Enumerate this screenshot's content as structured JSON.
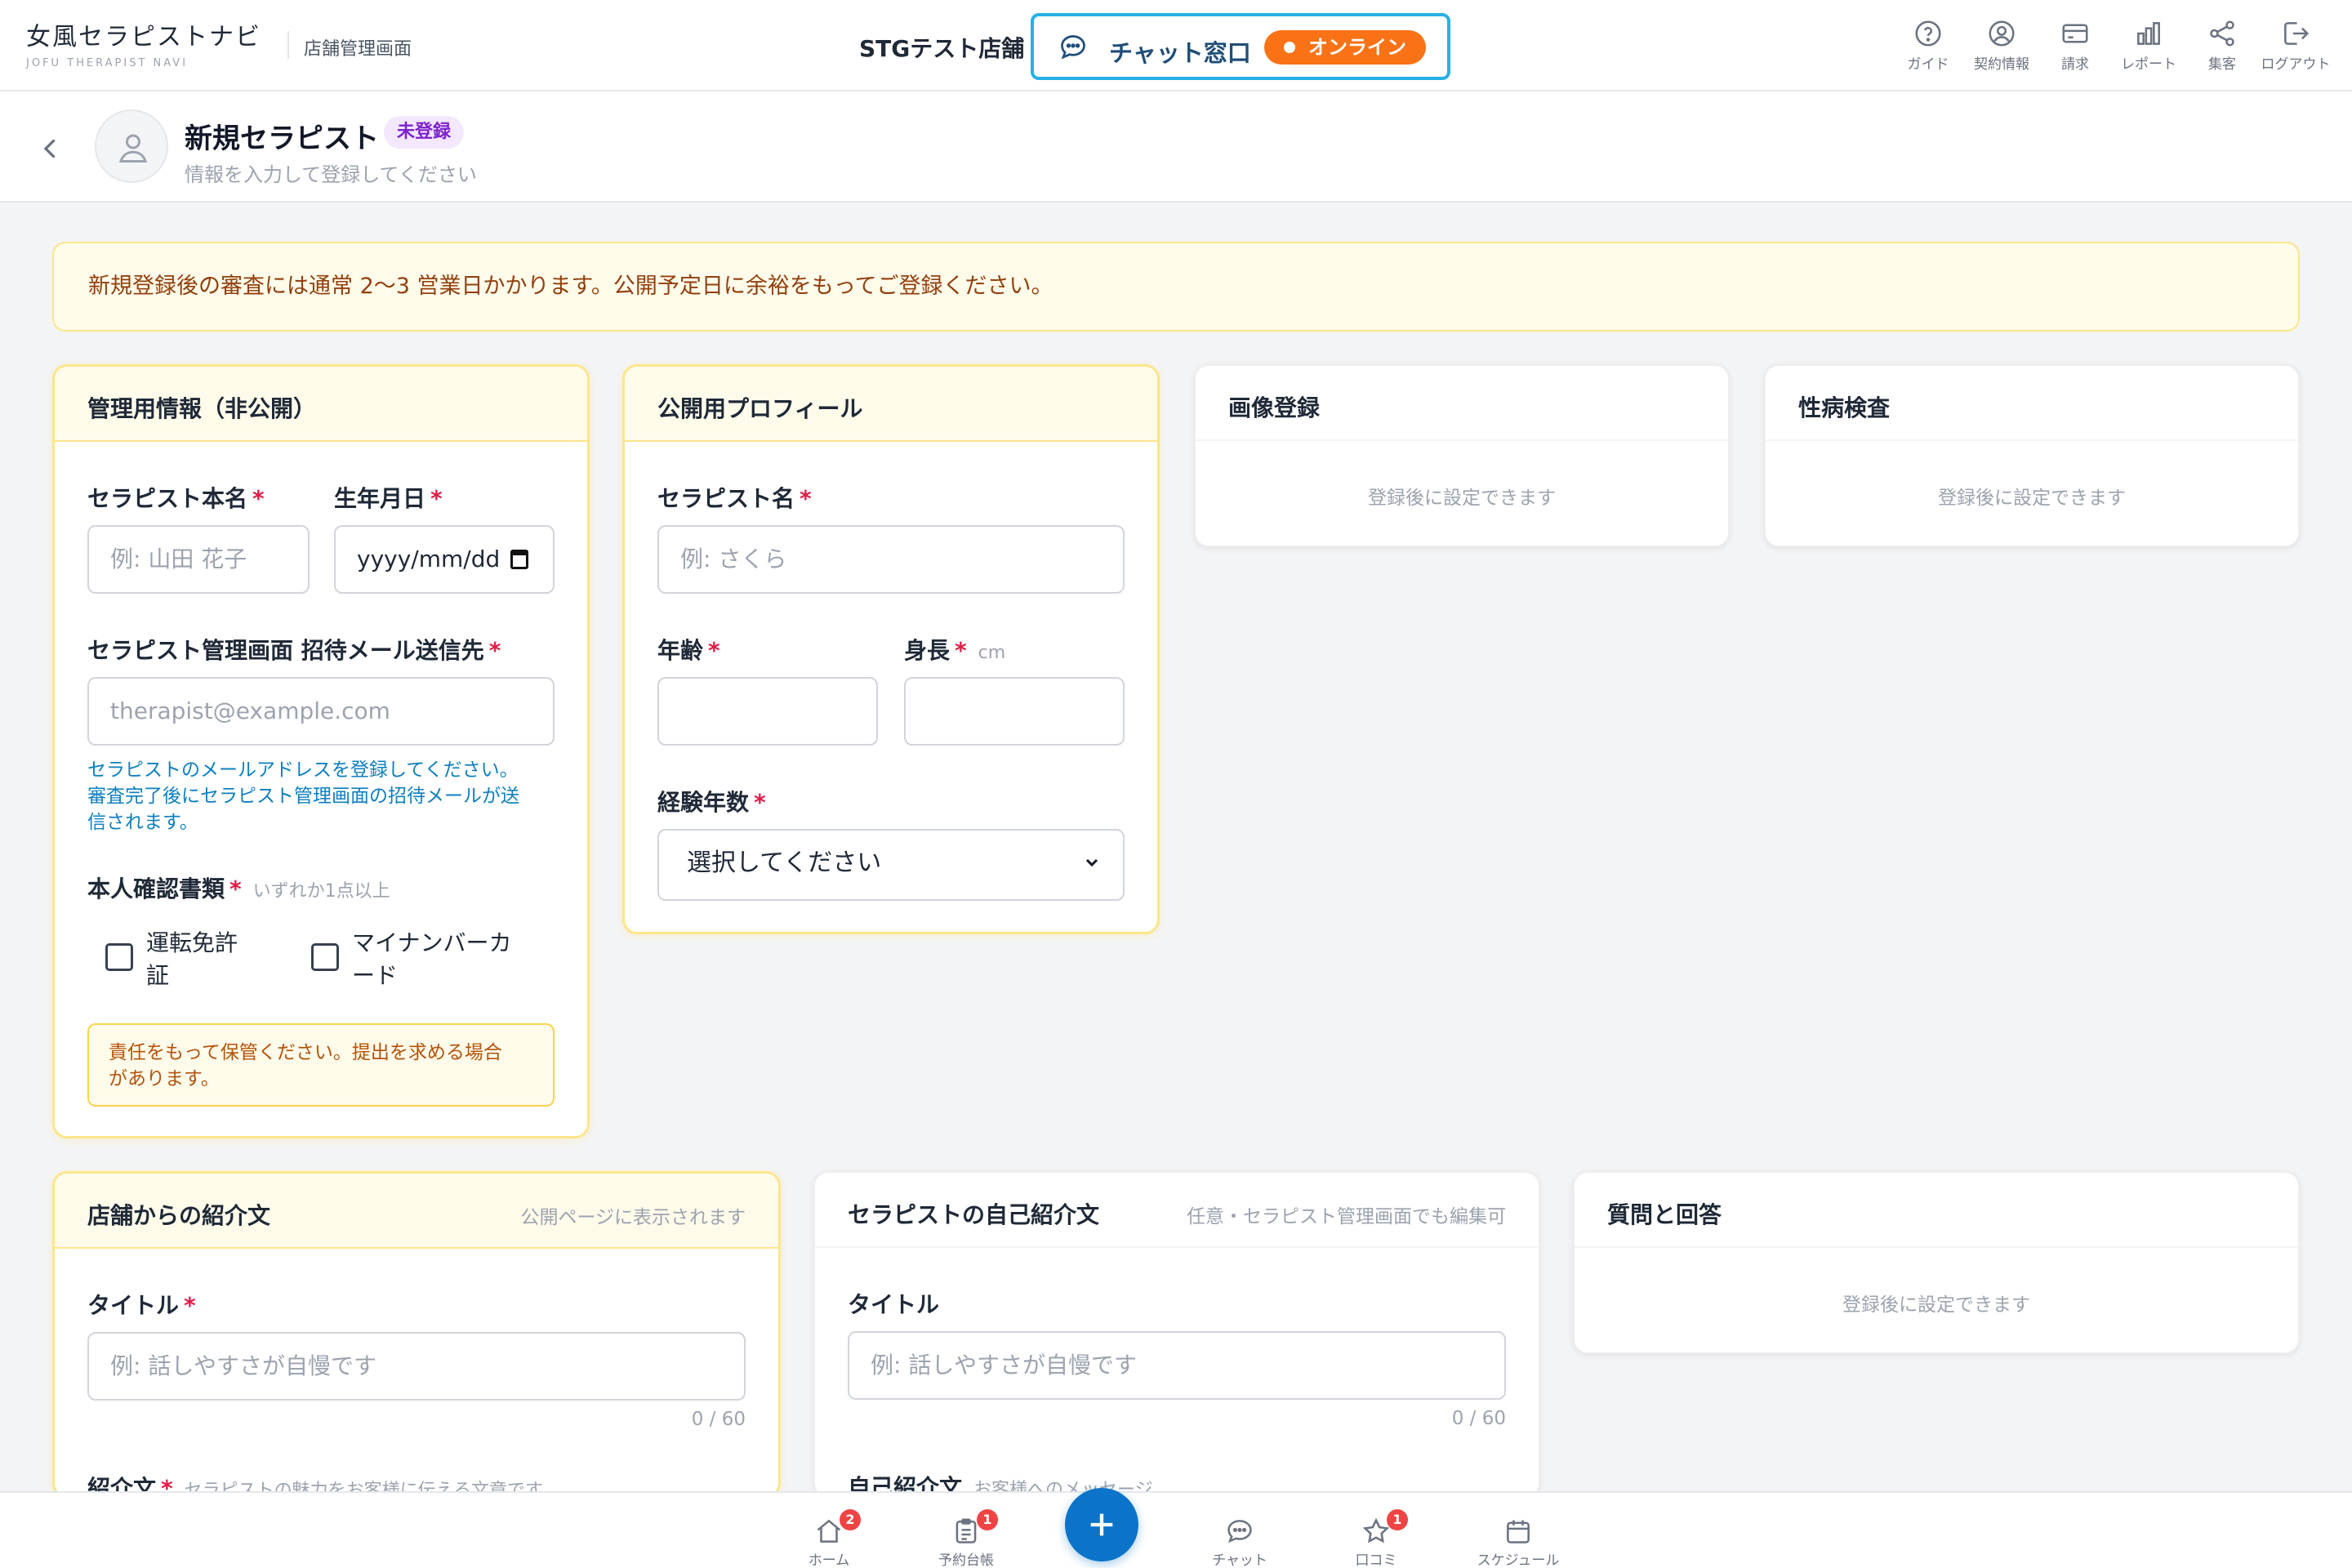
{
  "header": {
    "logo_main": "女風セラピストナビ",
    "logo_sub": "JOFU THERAPIST NAVI",
    "admin_label": "店舗管理画面",
    "store_name": "STGテスト店舗",
    "chat_label": "チャット窓口",
    "chat_status": "オンライン",
    "nav": [
      {
        "label": "ガイド",
        "icon": "help-circle-icon"
      },
      {
        "label": "契約情報",
        "icon": "user-circle-icon"
      },
      {
        "label": "請求",
        "icon": "credit-card-icon"
      },
      {
        "label": "レポート",
        "icon": "bar-chart-icon"
      },
      {
        "label": "集客",
        "icon": "share-icon"
      },
      {
        "label": "ログアウト",
        "icon": "logout-icon"
      }
    ]
  },
  "page": {
    "title": "新規セラピスト",
    "badge": "未登録",
    "subtitle": "情報を入力して登録してください"
  },
  "notice": "新規登録後の審査には通常 2〜3 営業日かかります。公開予定日に余裕をもってご登録ください。",
  "admin_card": {
    "title": "管理用情報（非公開）",
    "real_name_label": "セラピスト本名",
    "real_name_placeholder": "例: 山田 花子",
    "birthday_label": "生年月日",
    "birthday_value": "yyyy/mm/dd",
    "email_label": "セラピスト管理画面 招待メール送信先",
    "email_placeholder": "therapist@example.com",
    "email_help_1": "セラピストのメールアドレスを登録してください。",
    "email_help_2": "審査完了後にセラピスト管理画面の招待メールが送",
    "email_help_3": "信されます。",
    "id_doc_label": "本人確認書類",
    "id_doc_note": "いずれか1点以上",
    "doc1_line1": "運転免許",
    "doc1_line2": "証",
    "doc2_line1": "マイナンバーカ",
    "doc2_line2": "ード",
    "warn_1": "責任をもって保管ください。提出を求める場合",
    "warn_2": "があります。"
  },
  "profile_card": {
    "title": "公開用プロフィール",
    "name_label": "セラピスト名",
    "name_placeholder": "例: さくら",
    "age_label": "年齢",
    "height_label": "身長",
    "height_unit": "cm",
    "exp_label": "経験年数",
    "exp_selected": "選択してください"
  },
  "image_card": {
    "title": "画像登録",
    "message": "登録後に設定できます"
  },
  "std_card": {
    "title": "性病検査",
    "message": "登録後に設定できます"
  },
  "shop_intro_card": {
    "title": "店舗からの紹介文",
    "hint": "公開ページに表示されます",
    "title_label": "タイトル",
    "title_placeholder": "例: 話しやすさが自慢です",
    "counter": "0 / 60",
    "body_label": "紹介文",
    "body_note": "セラピストの魅力をお客様に伝える文章です"
  },
  "self_intro_card": {
    "title": "セラピストの自己紹介文",
    "hint": "任意・セラピスト管理画面でも編集可",
    "title_label": "タイトル",
    "title_placeholder": "例: 話しやすさが自慢です",
    "counter": "0 / 60",
    "body_label": "自己紹介文",
    "body_note": "お客様へのメッセージ"
  },
  "qa_card": {
    "title": "質問と回答",
    "message": "登録後に設定できます"
  },
  "required_mark": "*",
  "bottom_nav": {
    "items": [
      {
        "label": "ホーム",
        "badge": "2",
        "icon": "home-icon"
      },
      {
        "label": "予約台帳",
        "badge": "1",
        "icon": "clipboard-icon"
      },
      {
        "label": "チャット",
        "badge": "",
        "icon": "chat-bubble-icon"
      },
      {
        "label": "口コミ",
        "badge": "1",
        "icon": "star-icon"
      },
      {
        "label": "スケジュール",
        "badge": "",
        "icon": "calendar-icon"
      }
    ]
  },
  "colors": {
    "accent_blue": "#0b74c9",
    "chat_border": "#27b0e6",
    "online_orange": "#f97316",
    "required_red": "#e11d48",
    "badge_purple": "#7e22ce",
    "warning_border": "#fde68a"
  }
}
